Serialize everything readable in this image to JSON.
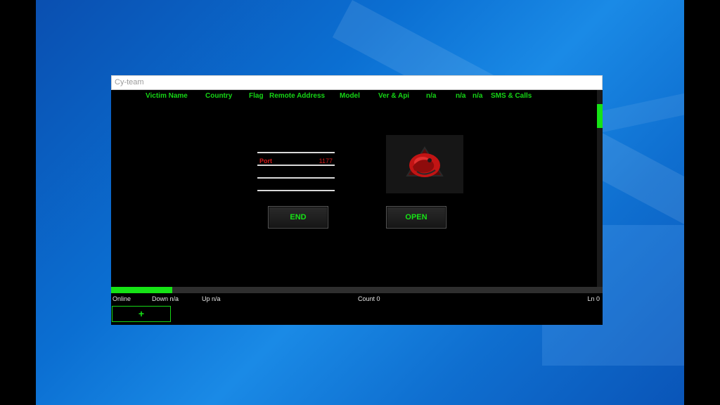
{
  "window": {
    "title": "Cy-team"
  },
  "table": {
    "columns": [
      "Victim Name",
      "Country",
      "Flag",
      "Remote Address",
      "Model",
      "Ver & Api",
      "n/a",
      "n/a",
      "n/a",
      "SMS & Calls"
    ]
  },
  "port": {
    "label": "Port",
    "value": "1177"
  },
  "buttons": {
    "end": "END",
    "open": "OPEN",
    "add": "+"
  },
  "status": {
    "online": "Online",
    "down": "Down n/a",
    "up": "Up n/a",
    "count": "Count 0",
    "ln": "Ln 0"
  },
  "icons": {
    "logo": "red-dragon-logo-icon"
  },
  "colors": {
    "accent": "#16e316",
    "port": "#d41a1a"
  }
}
